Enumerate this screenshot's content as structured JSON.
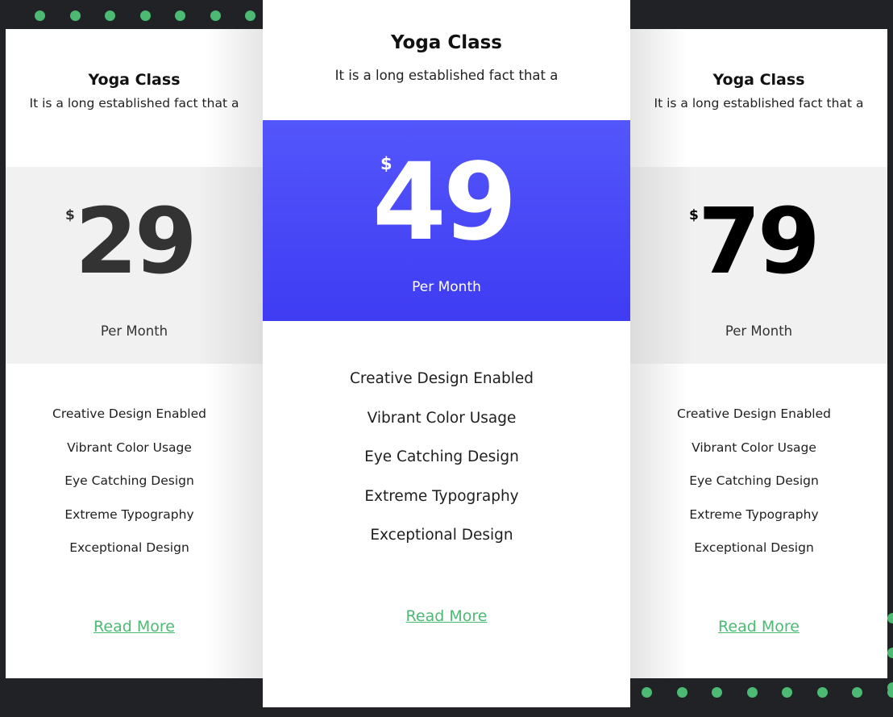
{
  "colors": {
    "background": "#212226",
    "accent_green": "#4cba73",
    "featured_blue": "#4a4af8"
  },
  "plans": [
    {
      "title": "Yoga Class",
      "description": "It is a long established fact that a",
      "currency": "$",
      "price": "29",
      "period": "Per Month",
      "features": [
        "Creative Design Enabled",
        "Vibrant Color Usage",
        "Eye Catching Design",
        "Extreme Typography",
        "Exceptional Design"
      ],
      "link_label": "Read More"
    },
    {
      "title": "Yoga Class",
      "description": "It is a long established fact that a",
      "currency": "$",
      "price": "49",
      "period": "Per Month",
      "features": [
        "Creative Design Enabled",
        "Vibrant Color Usage",
        "Eye Catching Design",
        "Extreme Typography",
        "Exceptional Design"
      ],
      "link_label": "Read More",
      "featured": true
    },
    {
      "title": "Yoga Class",
      "description": "It is a long established fact that a",
      "currency": "$",
      "price": "79",
      "period": "Per Month",
      "features": [
        "Creative Design Enabled",
        "Vibrant Color Usage",
        "Eye Catching Design",
        "Extreme Typography",
        "Exceptional Design"
      ],
      "link_label": "Read More"
    }
  ]
}
